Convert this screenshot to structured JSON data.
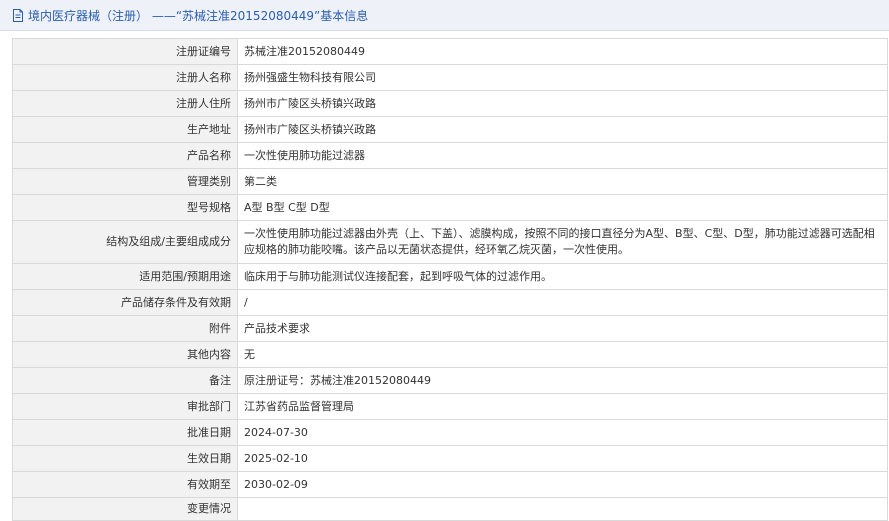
{
  "header": {
    "title": "境内医疗器械（注册） ——“苏械注准20152080449”基本信息",
    "icon": "document-icon",
    "accent_color": "#2a5db0"
  },
  "rows": [
    {
      "label": "注册证编号",
      "value": "苏械注准20152080449"
    },
    {
      "label": "注册人名称",
      "value": "扬州强盛生物科技有限公司"
    },
    {
      "label": "注册人住所",
      "value": "扬州市广陵区头桥镇兴政路"
    },
    {
      "label": "生产地址",
      "value": "扬州市广陵区头桥镇兴政路"
    },
    {
      "label": "产品名称",
      "value": "一次性使用肺功能过滤器"
    },
    {
      "label": "管理类别",
      "value": "第二类"
    },
    {
      "label": "型号规格",
      "value": "A型 B型 C型 D型"
    },
    {
      "label": "结构及组成/主要组成成分",
      "value": "一次性使用肺功能过滤器由外壳（上、下盖）、滤膜构成，按照不同的接口直径分为A型、B型、C型、D型，肺功能过滤器可选配相应规格的肺功能咬嘴。该产品以无菌状态提供，经环氧乙烷灭菌，一次性使用。"
    },
    {
      "label": "适用范围/预期用途",
      "value": "临床用于与肺功能测试仪连接配套，起到呼吸气体的过滤作用。"
    },
    {
      "label": "产品储存条件及有效期",
      "value": "/"
    },
    {
      "label": "附件",
      "value": "产品技术要求"
    },
    {
      "label": "其他内容",
      "value": "无"
    },
    {
      "label": "备注",
      "value": "原注册证号：苏械注准20152080449"
    },
    {
      "label": "审批部门",
      "value": "江苏省药品监督管理局"
    },
    {
      "label": "批准日期",
      "value": "2024-07-30"
    },
    {
      "label": "生效日期",
      "value": "2025-02-10"
    },
    {
      "label": "有效期至",
      "value": "2030-02-09"
    },
    {
      "label": "变更情况",
      "value": ""
    }
  ]
}
